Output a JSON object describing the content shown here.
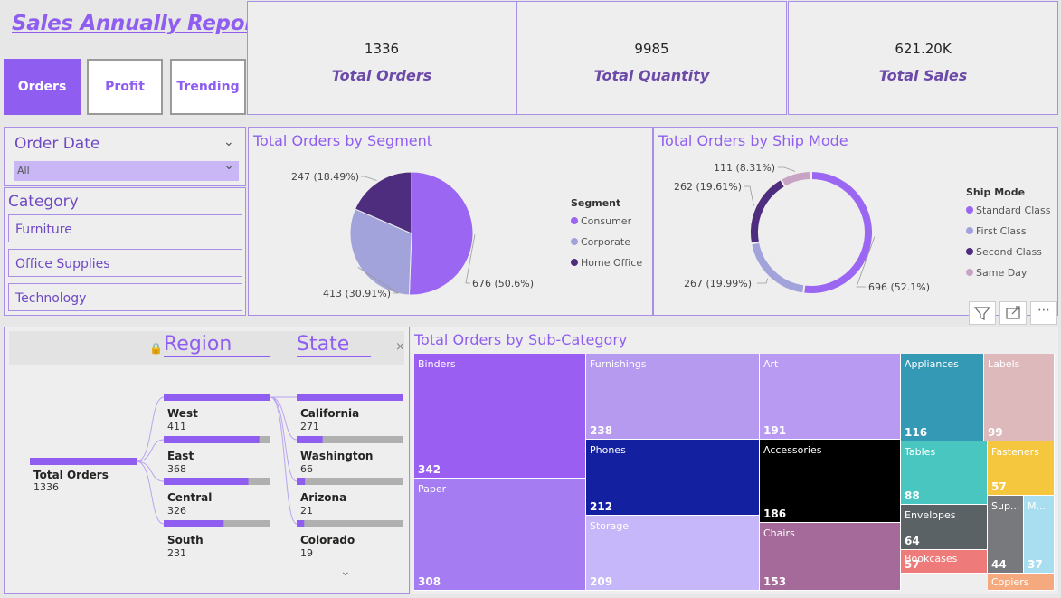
{
  "report_title": "Sales Annually Report",
  "nav": [
    {
      "label": "Orders",
      "active": true
    },
    {
      "label": "Profit",
      "active": false
    },
    {
      "label": "Trending",
      "active": false
    }
  ],
  "kpis": [
    {
      "value": "1336",
      "label": "Total Orders"
    },
    {
      "value": "9985",
      "label": "Total Quantity"
    },
    {
      "value": "621.20K",
      "label": "Total Sales"
    }
  ],
  "order_date": {
    "title": "Order Date",
    "selected": "All"
  },
  "category": {
    "title": "Category",
    "items": [
      "Furniture",
      "Office Supplies",
      "Technology"
    ]
  },
  "visual_icons": [
    "filter-icon",
    "focus-mode-icon",
    "more-options-icon"
  ],
  "colors": {
    "accent": "#8f5ef0",
    "light": "#a3a0dc",
    "dark": "#4b2a7b",
    "pink": "#c8a4c4"
  },
  "chart_data": [
    {
      "type": "pie",
      "title": "Total Orders by Segment",
      "legend_title": "Segment",
      "legend_position": "right",
      "categories": [
        "Consumer",
        "Corporate",
        "Home Office"
      ],
      "values": [
        676,
        413,
        247
      ],
      "labels": [
        "676 (50.6%)",
        "413 (30.91%)",
        "247 (18.49%)"
      ],
      "colors": [
        "#9a66f2",
        "#a3a3dc",
        "#4e2d7e"
      ]
    },
    {
      "type": "pie",
      "subtype": "donut",
      "title": "Total Orders by Ship Mode",
      "legend_title": "Ship Mode",
      "legend_position": "right",
      "categories": [
        "Standard Class",
        "First Class",
        "Second Class",
        "Same Day"
      ],
      "values": [
        696,
        267,
        262,
        111
      ],
      "labels": [
        "696 (52.1%)",
        "267 (19.99%)",
        "262 (19.61%)",
        "111 (8.31%)"
      ],
      "colors": [
        "#9a66f2",
        "#a3a3dc",
        "#4e2d7e",
        "#c8a4c4"
      ]
    },
    {
      "type": "decomposition-tree",
      "root": {
        "label": "Total Orders",
        "value": 1336
      },
      "levels": [
        "Region",
        "State"
      ],
      "region": [
        {
          "name": "West",
          "value": 411
        },
        {
          "name": "East",
          "value": 368
        },
        {
          "name": "Central",
          "value": 326
        },
        {
          "name": "South",
          "value": 231
        }
      ],
      "state": [
        {
          "name": "California",
          "value": 271
        },
        {
          "name": "Washington",
          "value": 66
        },
        {
          "name": "Arizona",
          "value": 21
        },
        {
          "name": "Colorado",
          "value": 19
        }
      ]
    },
    {
      "type": "treemap",
      "title": "Total Orders by Sub-Category",
      "categories": [
        "Binders",
        "Paper",
        "Furnishings",
        "Phones",
        "Storage",
        "Art",
        "Accessories",
        "Chairs",
        "Appliances",
        "Labels",
        "Tables",
        "Fasteners",
        "Envelopes",
        "Bookcases",
        "Supplies",
        "Machines",
        "Copiers"
      ],
      "labels": [
        "Binders",
        "Paper",
        "Furnishings",
        "Phones",
        "Storage",
        "Art",
        "Accessories",
        "Chairs",
        "Appliances",
        "Labels",
        "Tables",
        "Fasteners",
        "Envelopes",
        "Bookcases",
        "Sup...",
        "M...",
        "Copiers"
      ],
      "values": [
        342,
        308,
        238,
        212,
        209,
        191,
        186,
        153,
        116,
        99,
        88,
        57,
        64,
        57,
        44,
        37,
        null
      ],
      "colors": [
        "#9a5ff2",
        "#a57cf2",
        "#b69af0",
        "#1321a0",
        "#c6b6fa",
        "#b89af2",
        "#000000",
        "#a56a99",
        "#3499b5",
        "#ddb9bc",
        "#4ac6c0",
        "#f5c73f",
        "#5a6266",
        "#ee7a7a",
        "#78797c",
        "#a9def0",
        "#f5a97e"
      ]
    }
  ]
}
